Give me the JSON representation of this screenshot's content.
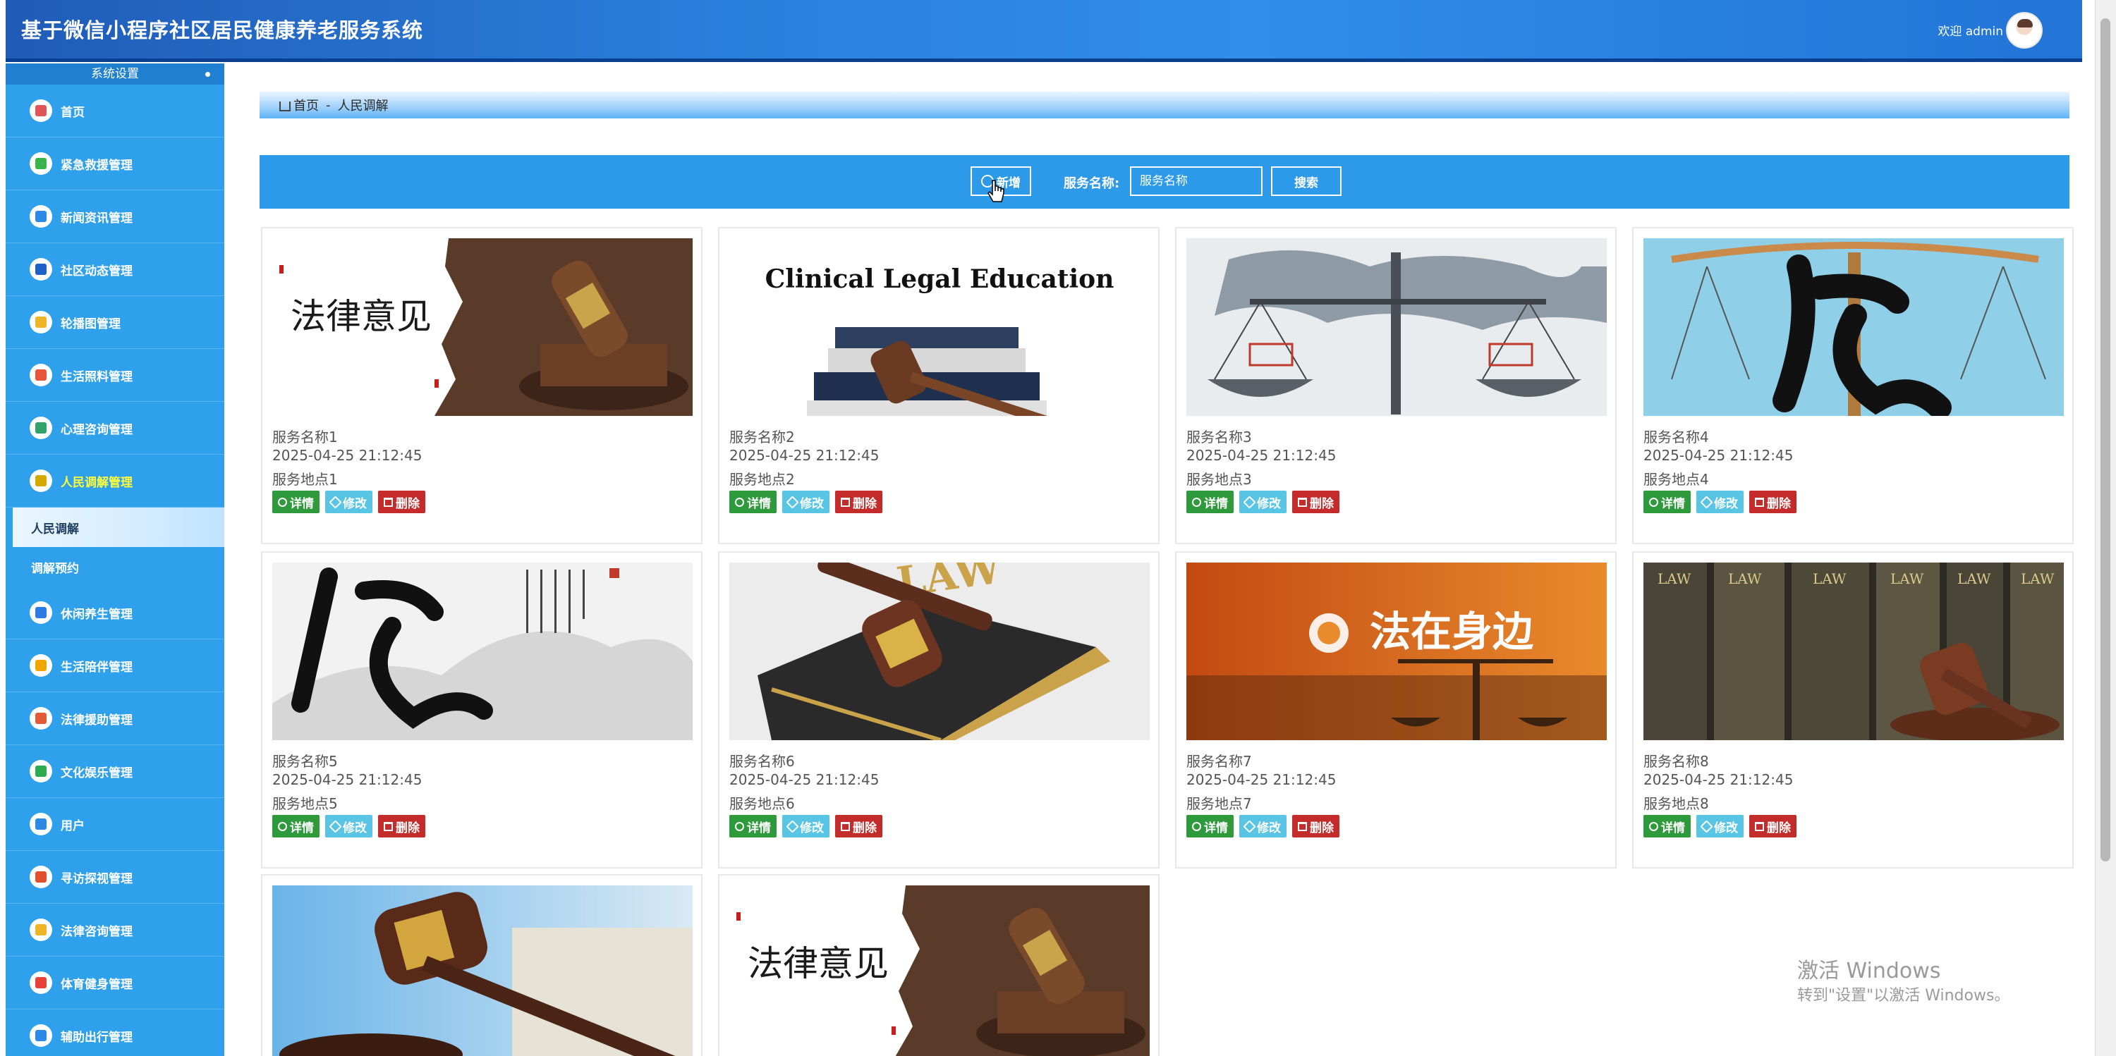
{
  "header": {
    "title": "基于微信小程序社区居民健康养老服务系统",
    "welcome": "欢迎 admin"
  },
  "sidebar": {
    "header": "系统设置",
    "items": [
      {
        "label": "首页",
        "icon": "home-icon",
        "color": "#e05656"
      },
      {
        "label": "紧急救援管理",
        "icon": "grid-icon",
        "color": "#38b44a"
      },
      {
        "label": "新闻资讯管理",
        "icon": "news-icon",
        "color": "#2c8ae6"
      },
      {
        "label": "社区动态管理",
        "icon": "community-icon",
        "color": "#1e5fc8"
      },
      {
        "label": "轮播图管理",
        "icon": "image-icon",
        "color": "#f0b429"
      },
      {
        "label": "生活照料管理",
        "icon": "care-icon",
        "color": "#e8553b"
      },
      {
        "label": "心理咨询管理",
        "icon": "heart-icon",
        "color": "#2fa36b"
      },
      {
        "label": "人民调解管理",
        "icon": "mediation-icon",
        "color": "#d4a900"
      }
    ],
    "subitems": [
      {
        "label": "人民调解"
      },
      {
        "label": "调解预约"
      }
    ],
    "items2": [
      {
        "label": "休闲养生管理",
        "icon": "leisure-icon",
        "color": "#2c7be5"
      },
      {
        "label": "生活陪伴管理",
        "icon": "companion-icon",
        "color": "#f0a500"
      },
      {
        "label": "法律援助管理",
        "icon": "legal-aid-icon",
        "color": "#e25a3a"
      },
      {
        "label": "文化娱乐管理",
        "icon": "culture-icon",
        "color": "#2da94f"
      },
      {
        "label": "用户",
        "icon": "user-icon",
        "color": "#2c8ae6"
      },
      {
        "label": "寻访探视管理",
        "icon": "visit-icon",
        "color": "#e0522f"
      },
      {
        "label": "法律咨询管理",
        "icon": "consult-icon",
        "color": "#f0b429"
      },
      {
        "label": "体育健身管理",
        "icon": "fitness-icon",
        "color": "#e8413a"
      },
      {
        "label": "辅助出行管理",
        "icon": "travel-icon",
        "color": "#2c8ae6"
      }
    ]
  },
  "breadcrumb": {
    "home": "首页",
    "sep": "-",
    "current": "人民调解"
  },
  "toolbar": {
    "add_label": "新增",
    "search_label": "服务名称:",
    "search_placeholder": "服务名称",
    "search_button": "搜索"
  },
  "cards": [
    {
      "name": "服务名称1",
      "time": "2025-04-25 21:12:45",
      "place": "服务地点1",
      "image": "gavel-opinion",
      "img_text": "法律意见"
    },
    {
      "name": "服务名称2",
      "time": "2025-04-25 21:12:45",
      "place": "服务地点2",
      "image": "clinical-legal-education",
      "img_text": "Clinical Legal Education"
    },
    {
      "name": "服务名称3",
      "time": "2025-04-25 21:12:45",
      "place": "服务地点3",
      "image": "scales-world"
    },
    {
      "name": "服务名称4",
      "time": "2025-04-25 21:12:45",
      "place": "服务地点4",
      "image": "scales-calligraphy"
    },
    {
      "name": "服务名称5",
      "time": "2025-04-25 21:12:45",
      "place": "服务地点5",
      "image": "ink-calligraphy"
    },
    {
      "name": "服务名称6",
      "time": "2025-04-25 21:12:45",
      "place": "服务地点6",
      "image": "law-book-gavel",
      "img_text": "LAW"
    },
    {
      "name": "服务名称7",
      "time": "2025-04-25 21:12:45",
      "place": "服务地点7",
      "image": "law-around-you",
      "img_text": "法在身边"
    },
    {
      "name": "服务名称8",
      "time": "2025-04-25 21:12:45",
      "place": "服务地点8",
      "image": "law-books-shelf"
    },
    {
      "image": "gavel-blue"
    },
    {
      "image": "gavel-opinion",
      "img_text": "法律意见"
    }
  ],
  "card_buttons": {
    "detail": "详情",
    "edit": "修改",
    "delete": "删除"
  },
  "watermark": {
    "line1": "激活 Windows",
    "line2": "转到\"设置\"以激活 Windows。"
  }
}
